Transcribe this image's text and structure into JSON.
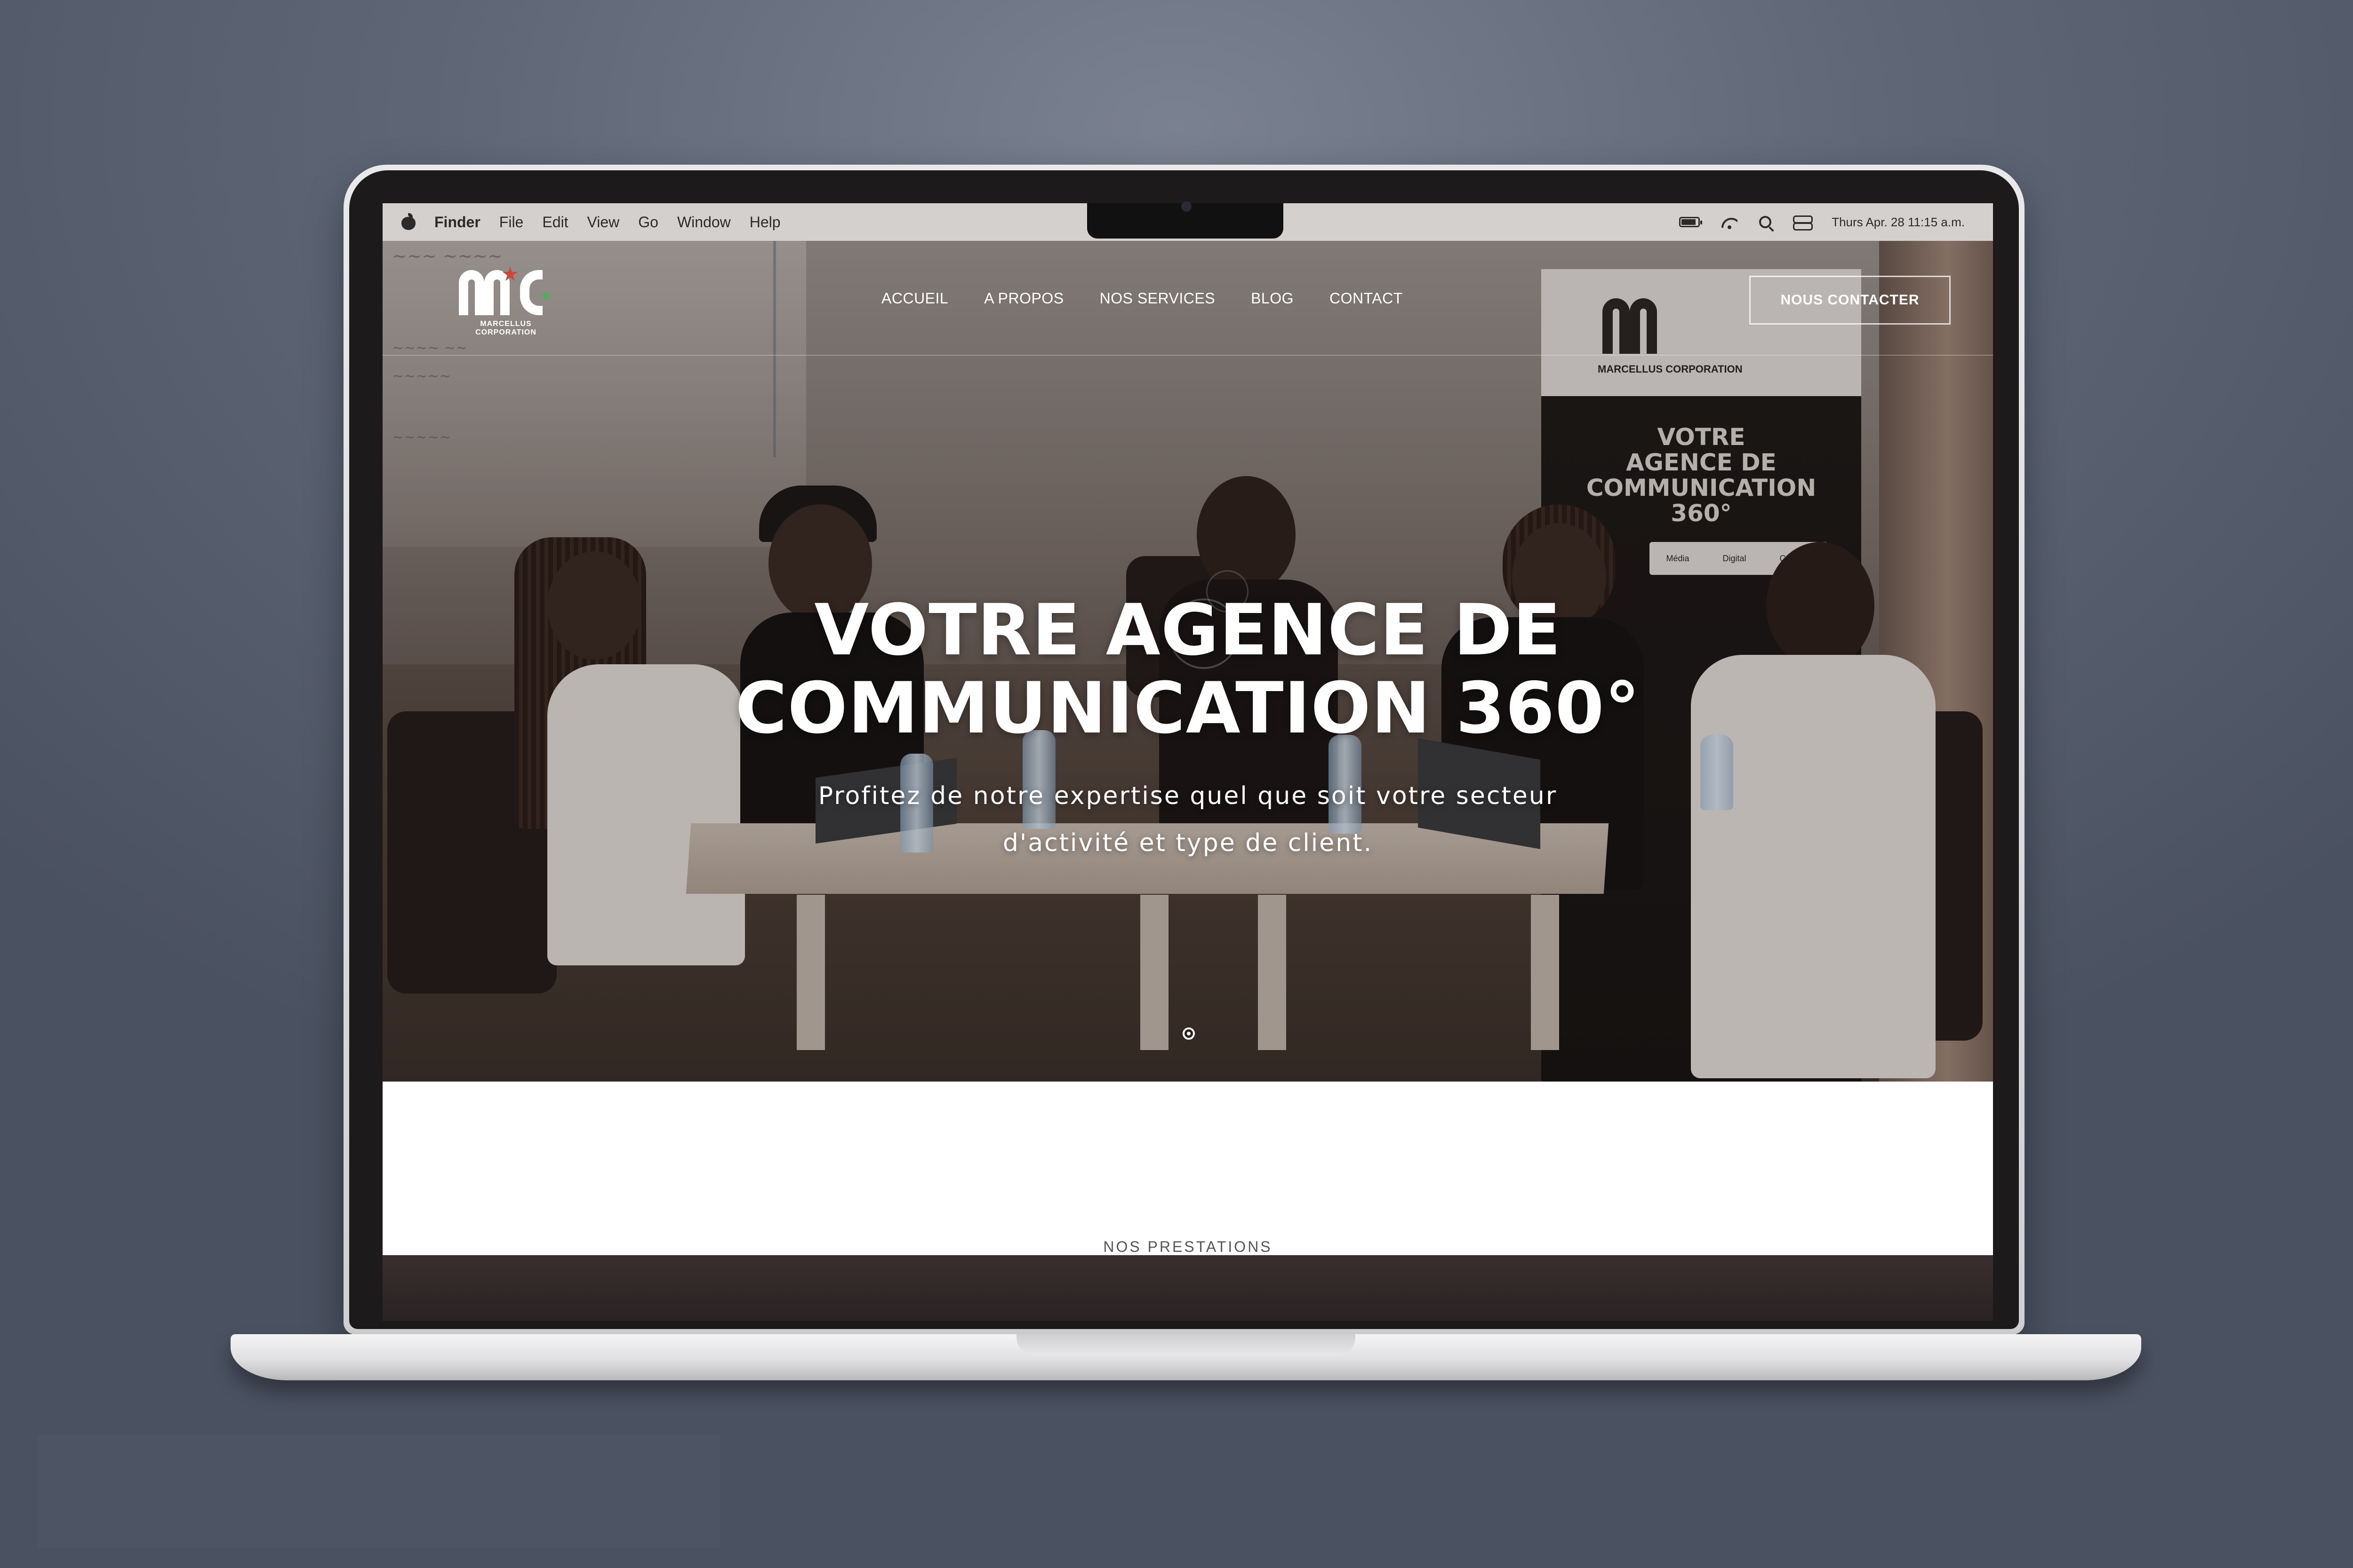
{
  "menubar": {
    "app": "Finder",
    "items": [
      "File",
      "Edit",
      "View",
      "Go",
      "Window",
      "Help"
    ],
    "clock": "Thurs Apr. 28 11:15 a.m."
  },
  "site": {
    "brand": "MARCELLUS CORPORATION",
    "nav": [
      "ACCUEIL",
      "A PROPOS",
      "NOS SERVICES",
      "BLOG",
      "CONTACT"
    ],
    "cta": "NOUS CONTACTER"
  },
  "hero": {
    "title": "VOTRE AGENCE DE\nCOMMUNICATION 360°",
    "subtitle": "Profitez de notre expertise quel que soit votre secteur\nd'activité et type de client.",
    "banner_brand": "MARCELLUS CORPORATION",
    "banner_headline": "VOTRE\nAGENCE DE\nCOMMUNICATION\n360°",
    "banner_tags": [
      "Média",
      "Digital",
      "Création"
    ],
    "slides_total": 1,
    "slide_active": 1
  },
  "section": {
    "label": "NOS PRESTATIONS"
  },
  "colors": {
    "accent_star": "#c8493a",
    "accent_dot": "#4fae5a",
    "menubar": "#d2cecc",
    "background": "#5f6777"
  },
  "icons": [
    "apple-icon",
    "battery-icon",
    "wifi-icon",
    "search-icon",
    "control-center-icon",
    "logo-star-icon",
    "slider-dot-icon"
  ]
}
